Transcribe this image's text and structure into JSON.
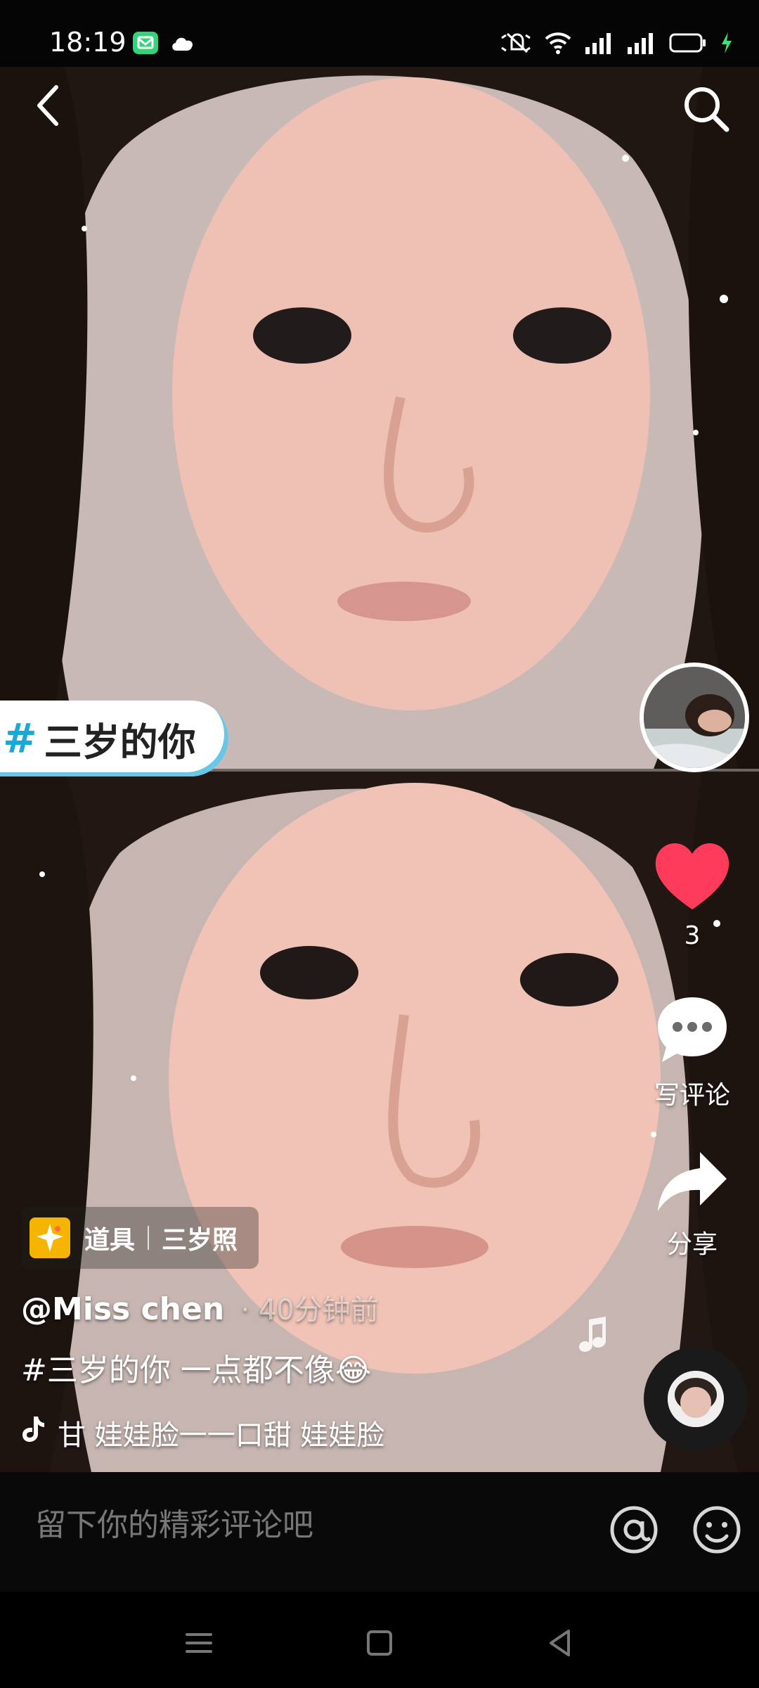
{
  "status_bar": {
    "time": "18:19",
    "icons": [
      "message-app-icon",
      "cloud-icon",
      "silent-icon",
      "wifi-icon",
      "signal-icon",
      "signal-icon",
      "battery-icon",
      "charging-icon"
    ]
  },
  "video": {
    "hashtag_banner": "三岁的你",
    "hashtag_symbol": "#",
    "likes": "3",
    "comment_label": "写评论",
    "share_label": "分享",
    "prop": {
      "label": "道具",
      "name": "三岁照"
    },
    "author": "@Miss chen",
    "posted_time": "· 40分钟前",
    "caption": "#三岁的你 一点都不像😂",
    "music": "甘   娃娃脸一一口甜   娃娃脸"
  },
  "comment_bar": {
    "placeholder": "留下你的精彩评论吧"
  },
  "colors": {
    "like": "#ff3b5c",
    "hashtag_blue": "#1aa9d6",
    "prop_badge": "#f5b400"
  }
}
